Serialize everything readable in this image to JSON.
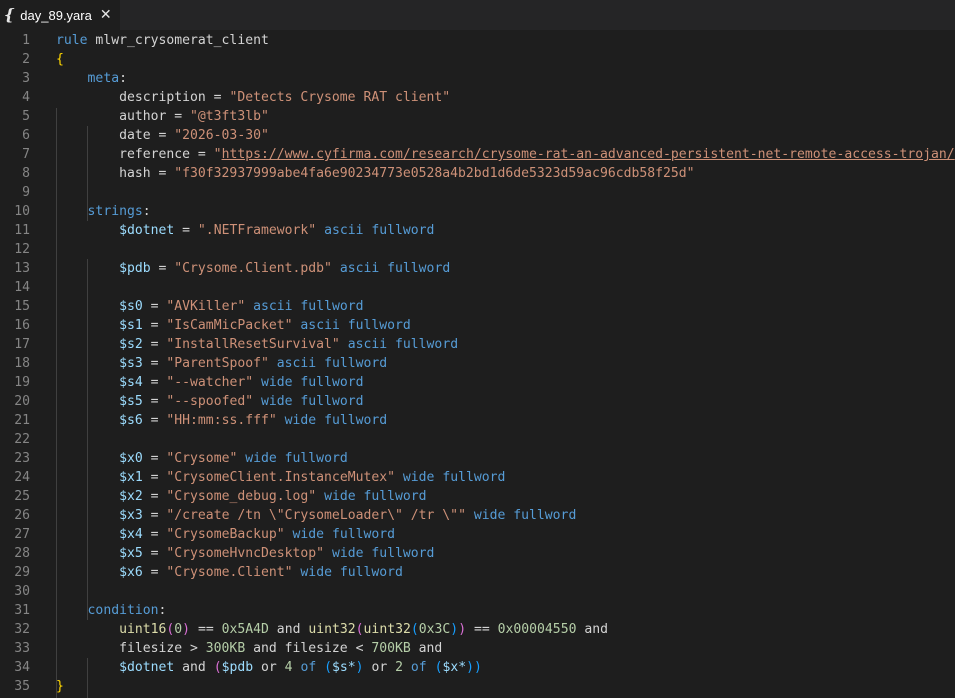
{
  "tab": {
    "icon": "{",
    "filename": "day_89.yara",
    "close": "✕"
  },
  "lines": [
    [
      [
        "kw",
        "rule "
      ],
      [
        "tx",
        "mlwr_crysomerat_client"
      ]
    ],
    [
      [
        "br1",
        "{"
      ]
    ],
    [
      [
        "tx",
        "    "
      ],
      [
        "kw",
        "meta"
      ],
      [
        "tx",
        ":"
      ]
    ],
    [
      [
        "tx",
        "        description = "
      ],
      [
        "st",
        "\"Detects Crysome RAT client\""
      ]
    ],
    [
      [
        "tx",
        "        author = "
      ],
      [
        "st",
        "\"@t3ft3lb\""
      ]
    ],
    [
      [
        "tx",
        "        date = "
      ],
      [
        "st",
        "\"2026-03-30\""
      ]
    ],
    [
      [
        "tx",
        "        reference = "
      ],
      [
        "st",
        "\""
      ],
      [
        "url",
        "https://www.cyfirma.com/research/crysome-rat-an-advanced-persistent-net-remote-access-trojan/"
      ],
      [
        "st",
        "\""
      ]
    ],
    [
      [
        "tx",
        "        hash = "
      ],
      [
        "st",
        "\"f30f32937999abe4fa6e90234773e0528a4b2bd1d6de5323d59ac96cdb58f25d\""
      ]
    ],
    [],
    [
      [
        "tx",
        "    "
      ],
      [
        "kw",
        "strings"
      ],
      [
        "tx",
        ":"
      ]
    ],
    [
      [
        "tx",
        "        "
      ],
      [
        "vr",
        "$dotnet"
      ],
      [
        "tx",
        " = "
      ],
      [
        "st",
        "\".NETFramework\""
      ],
      [
        "tx",
        " "
      ],
      [
        "kw",
        "ascii fullword"
      ]
    ],
    [],
    [
      [
        "tx",
        "        "
      ],
      [
        "vr",
        "$pdb"
      ],
      [
        "tx",
        " = "
      ],
      [
        "st",
        "\"Crysome.Client.pdb\""
      ],
      [
        "tx",
        " "
      ],
      [
        "kw",
        "ascii fullword"
      ]
    ],
    [],
    [
      [
        "tx",
        "        "
      ],
      [
        "vr",
        "$s0"
      ],
      [
        "tx",
        " = "
      ],
      [
        "st",
        "\"AVKiller\""
      ],
      [
        "tx",
        " "
      ],
      [
        "kw",
        "ascii fullword"
      ]
    ],
    [
      [
        "tx",
        "        "
      ],
      [
        "vr",
        "$s1"
      ],
      [
        "tx",
        " = "
      ],
      [
        "st",
        "\"IsCamMicPacket\""
      ],
      [
        "tx",
        " "
      ],
      [
        "kw",
        "ascii fullword"
      ]
    ],
    [
      [
        "tx",
        "        "
      ],
      [
        "vr",
        "$s2"
      ],
      [
        "tx",
        " = "
      ],
      [
        "st",
        "\"InstallResetSurvival\""
      ],
      [
        "tx",
        " "
      ],
      [
        "kw",
        "ascii fullword"
      ]
    ],
    [
      [
        "tx",
        "        "
      ],
      [
        "vr",
        "$s3"
      ],
      [
        "tx",
        " = "
      ],
      [
        "st",
        "\"ParentSpoof\""
      ],
      [
        "tx",
        " "
      ],
      [
        "kw",
        "ascii fullword"
      ]
    ],
    [
      [
        "tx",
        "        "
      ],
      [
        "vr",
        "$s4"
      ],
      [
        "tx",
        " = "
      ],
      [
        "st",
        "\"--watcher\""
      ],
      [
        "tx",
        " "
      ],
      [
        "kw",
        "wide fullword"
      ]
    ],
    [
      [
        "tx",
        "        "
      ],
      [
        "vr",
        "$s5"
      ],
      [
        "tx",
        " = "
      ],
      [
        "st",
        "\"--spoofed\""
      ],
      [
        "tx",
        " "
      ],
      [
        "kw",
        "wide fullword"
      ]
    ],
    [
      [
        "tx",
        "        "
      ],
      [
        "vr",
        "$s6"
      ],
      [
        "tx",
        " = "
      ],
      [
        "st",
        "\"HH:mm:ss.fff\""
      ],
      [
        "tx",
        " "
      ],
      [
        "kw",
        "wide fullword"
      ]
    ],
    [],
    [
      [
        "tx",
        "        "
      ],
      [
        "vr",
        "$x0"
      ],
      [
        "tx",
        " = "
      ],
      [
        "st",
        "\"Crysome\""
      ],
      [
        "tx",
        " "
      ],
      [
        "kw",
        "wide fullword"
      ]
    ],
    [
      [
        "tx",
        "        "
      ],
      [
        "vr",
        "$x1"
      ],
      [
        "tx",
        " = "
      ],
      [
        "st",
        "\"CrysomeClient.InstanceMutex\""
      ],
      [
        "tx",
        " "
      ],
      [
        "kw",
        "wide fullword"
      ]
    ],
    [
      [
        "tx",
        "        "
      ],
      [
        "vr",
        "$x2"
      ],
      [
        "tx",
        " = "
      ],
      [
        "st",
        "\"Crysome_debug.log\""
      ],
      [
        "tx",
        " "
      ],
      [
        "kw",
        "wide fullword"
      ]
    ],
    [
      [
        "tx",
        "        "
      ],
      [
        "vr",
        "$x3"
      ],
      [
        "tx",
        " = "
      ],
      [
        "st",
        "\"/create /tn \\\"CrysomeLoader\\\" /tr \\\"\""
      ],
      [
        "tx",
        " "
      ],
      [
        "kw",
        "wide fullword"
      ]
    ],
    [
      [
        "tx",
        "        "
      ],
      [
        "vr",
        "$x4"
      ],
      [
        "tx",
        " = "
      ],
      [
        "st",
        "\"CrysomeBackup\""
      ],
      [
        "tx",
        " "
      ],
      [
        "kw",
        "wide fullword"
      ]
    ],
    [
      [
        "tx",
        "        "
      ],
      [
        "vr",
        "$x5"
      ],
      [
        "tx",
        " = "
      ],
      [
        "st",
        "\"CrysomeHvncDesktop\""
      ],
      [
        "tx",
        " "
      ],
      [
        "kw",
        "wide fullword"
      ]
    ],
    [
      [
        "tx",
        "        "
      ],
      [
        "vr",
        "$x6"
      ],
      [
        "tx",
        " = "
      ],
      [
        "st",
        "\"Crysome.Client\""
      ],
      [
        "tx",
        " "
      ],
      [
        "kw",
        "wide fullword"
      ]
    ],
    [],
    [
      [
        "tx",
        "    "
      ],
      [
        "kw",
        "condition"
      ],
      [
        "tx",
        ":"
      ]
    ],
    [
      [
        "tx",
        "        "
      ],
      [
        "fn",
        "uint16"
      ],
      [
        "br2",
        "("
      ],
      [
        "nm",
        "0"
      ],
      [
        "br2",
        ")"
      ],
      [
        "tx",
        " == "
      ],
      [
        "nm",
        "0x5A4D"
      ],
      [
        "tx",
        " and "
      ],
      [
        "fn",
        "uint32"
      ],
      [
        "br2",
        "("
      ],
      [
        "fn",
        "uint32"
      ],
      [
        "br3",
        "("
      ],
      [
        "nm",
        "0x3C"
      ],
      [
        "br3",
        ")"
      ],
      [
        "br2",
        ")"
      ],
      [
        "tx",
        " == "
      ],
      [
        "nm",
        "0x00004550"
      ],
      [
        "tx",
        " and"
      ]
    ],
    [
      [
        "tx",
        "        filesize > "
      ],
      [
        "nm",
        "300KB"
      ],
      [
        "tx",
        " and filesize < "
      ],
      [
        "nm",
        "700KB"
      ],
      [
        "tx",
        " and"
      ]
    ],
    [
      [
        "tx",
        "        "
      ],
      [
        "vr",
        "$dotnet"
      ],
      [
        "tx",
        " and "
      ],
      [
        "br2",
        "("
      ],
      [
        "vr",
        "$pdb"
      ],
      [
        "tx",
        " or "
      ],
      [
        "nm",
        "4"
      ],
      [
        "tx",
        " "
      ],
      [
        "kw",
        "of"
      ],
      [
        "tx",
        " "
      ],
      [
        "br3",
        "("
      ],
      [
        "vr",
        "$s*"
      ],
      [
        "br3",
        ")"
      ],
      [
        "tx",
        " or "
      ],
      [
        "nm",
        "2"
      ],
      [
        "tx",
        " "
      ],
      [
        "kw",
        "of"
      ],
      [
        "tx",
        " "
      ],
      [
        "br3",
        "("
      ],
      [
        "vr",
        "$x*"
      ],
      [
        "br3",
        "))"
      ]
    ],
    [
      [
        "br1",
        "}"
      ]
    ]
  ],
  "line_numbers": [
    "1",
    "2",
    "3",
    "4",
    "5",
    "6",
    "7",
    "8",
    "9",
    "10",
    "11",
    "12",
    "13",
    "14",
    "15",
    "16",
    "17",
    "18",
    "19",
    "20",
    "21",
    "22",
    "23",
    "24",
    "25",
    "26",
    "27",
    "28",
    "29",
    "30",
    "31",
    "32",
    "33",
    "34",
    "35"
  ]
}
